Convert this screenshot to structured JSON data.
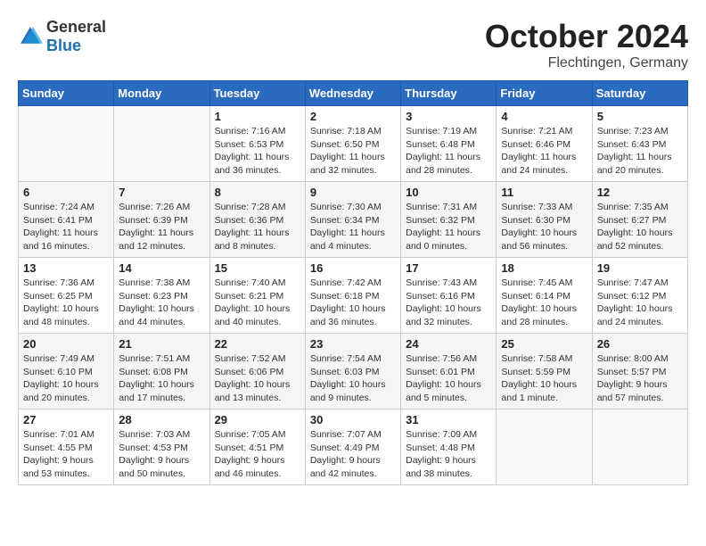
{
  "logo": {
    "text_general": "General",
    "text_blue": "Blue"
  },
  "header": {
    "month": "October 2024",
    "location": "Flechtingen, Germany"
  },
  "days_of_week": [
    "Sunday",
    "Monday",
    "Tuesday",
    "Wednesday",
    "Thursday",
    "Friday",
    "Saturday"
  ],
  "weeks": [
    [
      {
        "day": "",
        "detail": ""
      },
      {
        "day": "",
        "detail": ""
      },
      {
        "day": "1",
        "detail": "Sunrise: 7:16 AM\nSunset: 6:53 PM\nDaylight: 11 hours\nand 36 minutes."
      },
      {
        "day": "2",
        "detail": "Sunrise: 7:18 AM\nSunset: 6:50 PM\nDaylight: 11 hours\nand 32 minutes."
      },
      {
        "day": "3",
        "detail": "Sunrise: 7:19 AM\nSunset: 6:48 PM\nDaylight: 11 hours\nand 28 minutes."
      },
      {
        "day": "4",
        "detail": "Sunrise: 7:21 AM\nSunset: 6:46 PM\nDaylight: 11 hours\nand 24 minutes."
      },
      {
        "day": "5",
        "detail": "Sunrise: 7:23 AM\nSunset: 6:43 PM\nDaylight: 11 hours\nand 20 minutes."
      }
    ],
    [
      {
        "day": "6",
        "detail": "Sunrise: 7:24 AM\nSunset: 6:41 PM\nDaylight: 11 hours\nand 16 minutes."
      },
      {
        "day": "7",
        "detail": "Sunrise: 7:26 AM\nSunset: 6:39 PM\nDaylight: 11 hours\nand 12 minutes."
      },
      {
        "day": "8",
        "detail": "Sunrise: 7:28 AM\nSunset: 6:36 PM\nDaylight: 11 hours\nand 8 minutes."
      },
      {
        "day": "9",
        "detail": "Sunrise: 7:30 AM\nSunset: 6:34 PM\nDaylight: 11 hours\nand 4 minutes."
      },
      {
        "day": "10",
        "detail": "Sunrise: 7:31 AM\nSunset: 6:32 PM\nDaylight: 11 hours\nand 0 minutes."
      },
      {
        "day": "11",
        "detail": "Sunrise: 7:33 AM\nSunset: 6:30 PM\nDaylight: 10 hours\nand 56 minutes."
      },
      {
        "day": "12",
        "detail": "Sunrise: 7:35 AM\nSunset: 6:27 PM\nDaylight: 10 hours\nand 52 minutes."
      }
    ],
    [
      {
        "day": "13",
        "detail": "Sunrise: 7:36 AM\nSunset: 6:25 PM\nDaylight: 10 hours\nand 48 minutes."
      },
      {
        "day": "14",
        "detail": "Sunrise: 7:38 AM\nSunset: 6:23 PM\nDaylight: 10 hours\nand 44 minutes."
      },
      {
        "day": "15",
        "detail": "Sunrise: 7:40 AM\nSunset: 6:21 PM\nDaylight: 10 hours\nand 40 minutes."
      },
      {
        "day": "16",
        "detail": "Sunrise: 7:42 AM\nSunset: 6:18 PM\nDaylight: 10 hours\nand 36 minutes."
      },
      {
        "day": "17",
        "detail": "Sunrise: 7:43 AM\nSunset: 6:16 PM\nDaylight: 10 hours\nand 32 minutes."
      },
      {
        "day": "18",
        "detail": "Sunrise: 7:45 AM\nSunset: 6:14 PM\nDaylight: 10 hours\nand 28 minutes."
      },
      {
        "day": "19",
        "detail": "Sunrise: 7:47 AM\nSunset: 6:12 PM\nDaylight: 10 hours\nand 24 minutes."
      }
    ],
    [
      {
        "day": "20",
        "detail": "Sunrise: 7:49 AM\nSunset: 6:10 PM\nDaylight: 10 hours\nand 20 minutes."
      },
      {
        "day": "21",
        "detail": "Sunrise: 7:51 AM\nSunset: 6:08 PM\nDaylight: 10 hours\nand 17 minutes."
      },
      {
        "day": "22",
        "detail": "Sunrise: 7:52 AM\nSunset: 6:06 PM\nDaylight: 10 hours\nand 13 minutes."
      },
      {
        "day": "23",
        "detail": "Sunrise: 7:54 AM\nSunset: 6:03 PM\nDaylight: 10 hours\nand 9 minutes."
      },
      {
        "day": "24",
        "detail": "Sunrise: 7:56 AM\nSunset: 6:01 PM\nDaylight: 10 hours\nand 5 minutes."
      },
      {
        "day": "25",
        "detail": "Sunrise: 7:58 AM\nSunset: 5:59 PM\nDaylight: 10 hours\nand 1 minute."
      },
      {
        "day": "26",
        "detail": "Sunrise: 8:00 AM\nSunset: 5:57 PM\nDaylight: 9 hours\nand 57 minutes."
      }
    ],
    [
      {
        "day": "27",
        "detail": "Sunrise: 7:01 AM\nSunset: 4:55 PM\nDaylight: 9 hours\nand 53 minutes."
      },
      {
        "day": "28",
        "detail": "Sunrise: 7:03 AM\nSunset: 4:53 PM\nDaylight: 9 hours\nand 50 minutes."
      },
      {
        "day": "29",
        "detail": "Sunrise: 7:05 AM\nSunset: 4:51 PM\nDaylight: 9 hours\nand 46 minutes."
      },
      {
        "day": "30",
        "detail": "Sunrise: 7:07 AM\nSunset: 4:49 PM\nDaylight: 9 hours\nand 42 minutes."
      },
      {
        "day": "31",
        "detail": "Sunrise: 7:09 AM\nSunset: 4:48 PM\nDaylight: 9 hours\nand 38 minutes."
      },
      {
        "day": "",
        "detail": ""
      },
      {
        "day": "",
        "detail": ""
      }
    ]
  ]
}
